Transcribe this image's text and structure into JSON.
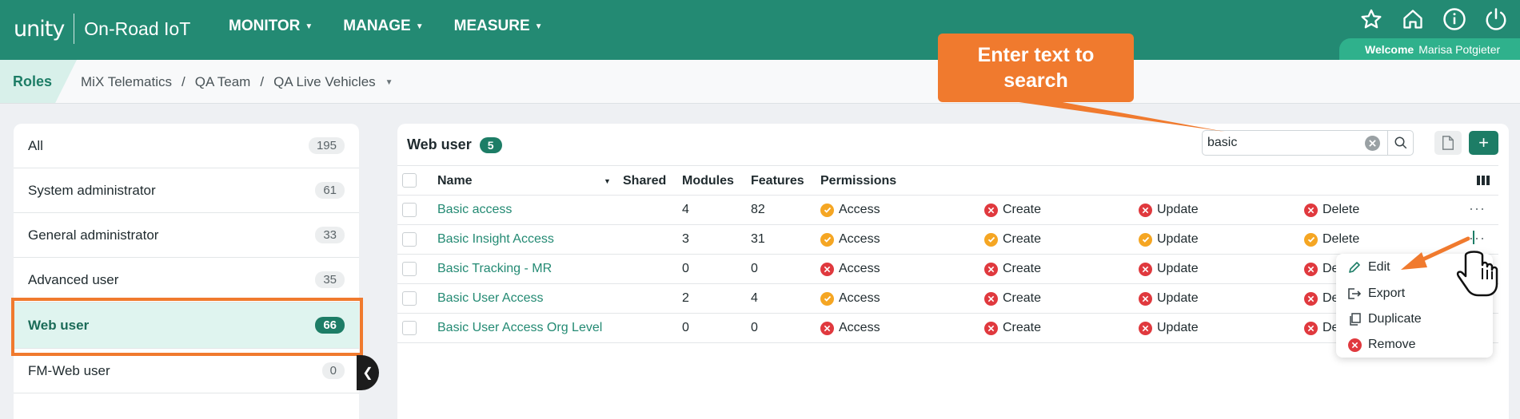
{
  "header": {
    "logo_brand": "unity",
    "logo_app": "On-Road IoT",
    "nav": [
      {
        "label": "MONITOR"
      },
      {
        "label": "MANAGE"
      },
      {
        "label": "MEASURE"
      }
    ],
    "welcome_label": "Welcome",
    "user_name": "Marisa Potgieter"
  },
  "breadcrumb": {
    "section": "Roles",
    "items": [
      "MiX Telematics",
      "QA Team",
      "QA Live Vehicles"
    ],
    "separator": "/"
  },
  "sidebar": {
    "items": [
      {
        "label": "All",
        "count": "195"
      },
      {
        "label": "System administrator",
        "count": "61"
      },
      {
        "label": "General administrator",
        "count": "33"
      },
      {
        "label": "Advanced user",
        "count": "35"
      },
      {
        "label": "Web user",
        "count": "66",
        "selected": true
      },
      {
        "label": "FM-Web user",
        "count": "0"
      }
    ]
  },
  "main": {
    "title": "Web user",
    "count": "5",
    "search": {
      "value": "basic",
      "placeholder": ""
    },
    "columns": {
      "name": "Name",
      "shared": "Shared",
      "modules": "Modules",
      "features": "Features",
      "permissions": "Permissions"
    },
    "rows": [
      {
        "name": "Basic access",
        "modules": "4",
        "features": "82",
        "perms": [
          {
            "label": "Access",
            "ok": true
          },
          {
            "label": "Create",
            "ok": false
          },
          {
            "label": "Update",
            "ok": false
          },
          {
            "label": "Delete",
            "ok": false
          }
        ]
      },
      {
        "name": "Basic Insight Access",
        "modules": "3",
        "features": "31",
        "perms": [
          {
            "label": "Access",
            "ok": true
          },
          {
            "label": "Create",
            "ok": true
          },
          {
            "label": "Update",
            "ok": true
          },
          {
            "label": "Delete",
            "ok": true
          }
        ]
      },
      {
        "name": "Basic Tracking - MR",
        "modules": "0",
        "features": "0",
        "perms": [
          {
            "label": "Access",
            "ok": false
          },
          {
            "label": "Create",
            "ok": false
          },
          {
            "label": "Update",
            "ok": false
          },
          {
            "label": "De",
            "ok": false
          }
        ]
      },
      {
        "name": "Basic User Access",
        "modules": "2",
        "features": "4",
        "perms": [
          {
            "label": "Access",
            "ok": true
          },
          {
            "label": "Create",
            "ok": false
          },
          {
            "label": "Update",
            "ok": false
          },
          {
            "label": "De",
            "ok": false
          }
        ]
      },
      {
        "name": "Basic User Access Org Level",
        "modules": "0",
        "features": "0",
        "perms": [
          {
            "label": "Access",
            "ok": false
          },
          {
            "label": "Create",
            "ok": false
          },
          {
            "label": "Update",
            "ok": false
          },
          {
            "label": "De",
            "ok": false
          }
        ]
      }
    ]
  },
  "context_menu": {
    "items": [
      {
        "label": "Edit",
        "icon": "pencil-icon"
      },
      {
        "label": "Export",
        "icon": "export-icon"
      },
      {
        "label": "Duplicate",
        "icon": "copy-icon"
      },
      {
        "label": "Remove",
        "icon": "remove-icon"
      }
    ]
  },
  "callout": {
    "text_line1": "Enter text to",
    "text_line2": "search"
  },
  "colors": {
    "header_bg": "#238a73",
    "accent": "#1d7d66",
    "annotation": "#f07a2e",
    "ok": "#f5a623",
    "deny": "#e0393e"
  }
}
